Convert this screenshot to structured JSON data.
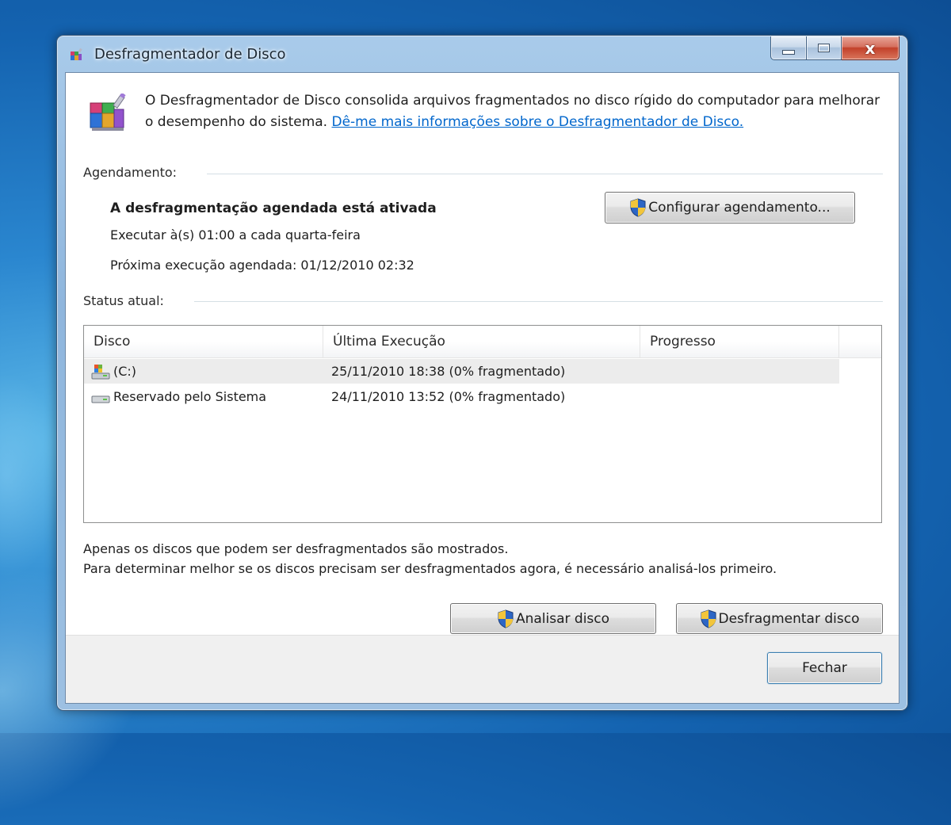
{
  "window": {
    "title": "Desfragmentador de Disco",
    "close_label": "x"
  },
  "header": {
    "description": "O Desfragmentador de Disco consolida arquivos fragmentados no disco rígido do computador para melhorar o desempenho do sistema.",
    "link_text": "Dê-me mais informações sobre o Desfragmentador de Disco."
  },
  "schedule": {
    "label": "Agendamento:",
    "status": "A desfragmentação agendada está ativada",
    "run_text": "Executar à(s) 01:00 a cada quarta-feira",
    "next_run": "Próxima execução agendada: 01/12/2010 02:32",
    "configure_button": "Configurar agendamento..."
  },
  "status": {
    "label": "Status atual:",
    "columns": [
      "Disco",
      "Última Execução",
      "Progresso"
    ],
    "rows": [
      {
        "disk": "(C:)",
        "last_run": "25/11/2010 18:38 (0% fragmentado)",
        "progress": "",
        "icon": "system-drive-icon",
        "selected": true
      },
      {
        "disk": "Reservado pelo Sistema",
        "last_run": "24/11/2010 13:52 (0% fragmentado)",
        "progress": "",
        "icon": "drive-icon",
        "selected": false
      }
    ]
  },
  "notes": {
    "line1": "Apenas os discos que podem ser desfragmentados são mostrados.",
    "line2": "Para determinar melhor se os discos precisam ser desfragmentados agora, é necessário analisá-los primeiro."
  },
  "actions": {
    "analyze_button": "Analisar disco",
    "defrag_button": "Desfragmentar disco",
    "close_button": "Fechar"
  },
  "colors": {
    "link": "#0066cc",
    "close_button": "#c2402a",
    "selected_row": "#ececec"
  }
}
